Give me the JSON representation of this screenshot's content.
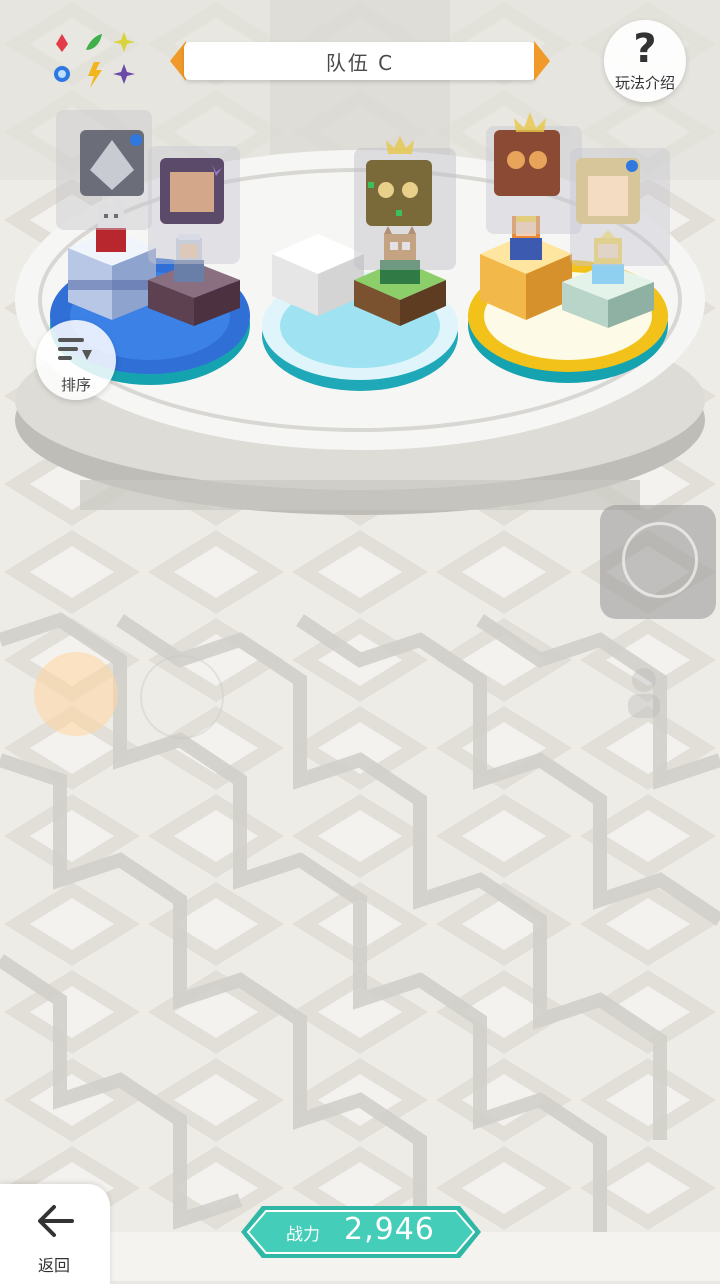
{
  "team": {
    "title": "队伍 C"
  },
  "help": {
    "symbol": "?",
    "label": "玩法介绍"
  },
  "sort": {
    "label": "排序"
  },
  "back": {
    "label": "返回"
  },
  "power": {
    "label": "战力",
    "value": "2,946"
  },
  "colors": {
    "accent_orange": "#f09a2a",
    "power_teal": "#3cc8b4",
    "platform_blue": "#2f6fd6",
    "platform_cyan": "#9fe3f2",
    "platform_gold": "#f2c21b",
    "floor_light": "#eeece6",
    "floor_dark": "#cfccc5"
  },
  "elements": [
    "fire-icon",
    "leaf-icon",
    "light-icon",
    "water-icon",
    "thunder-icon",
    "dark-icon"
  ],
  "party": {
    "groups": [
      {
        "color": "blue",
        "members": [
          "wolf-warrior",
          "silver-haired-elder"
        ]
      },
      {
        "color": "cyan",
        "members": [
          "empty-slot",
          "owl-leader"
        ]
      },
      {
        "color": "gold",
        "members": [
          "goggles-girl",
          "blonde-princess"
        ]
      }
    ]
  }
}
